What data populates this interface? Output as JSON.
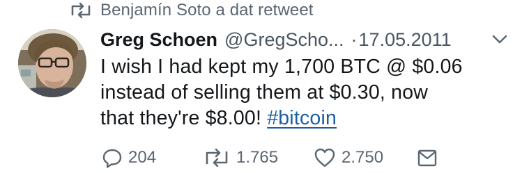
{
  "retweet_context": {
    "text": "Benjamín Soto a dat retweet",
    "icon": "retweet-icon"
  },
  "tweet": {
    "author_name": "Greg Schoen",
    "author_handle": "@GregScho...",
    "separator": "·",
    "date": "17.05.2011",
    "text_lines": [
      "I wish I had kept my 1,700 BTC @ $0.06",
      "instead of selling them at $0.30, now",
      "that they're $8.00!"
    ],
    "hashtag": "#bitcoin",
    "menu_icon": "chevron-down-icon"
  },
  "actions": {
    "reply": {
      "icon": "reply-icon",
      "count": "204"
    },
    "retweet": {
      "icon": "retweet-icon",
      "count": "1.765"
    },
    "like": {
      "icon": "heart-icon",
      "count": "2.750"
    },
    "dm": {
      "icon": "envelope-icon"
    }
  },
  "colors": {
    "text": "#14171a",
    "secondary": "#5b6670",
    "link": "#1b5fa3",
    "background": "#ffffff"
  }
}
